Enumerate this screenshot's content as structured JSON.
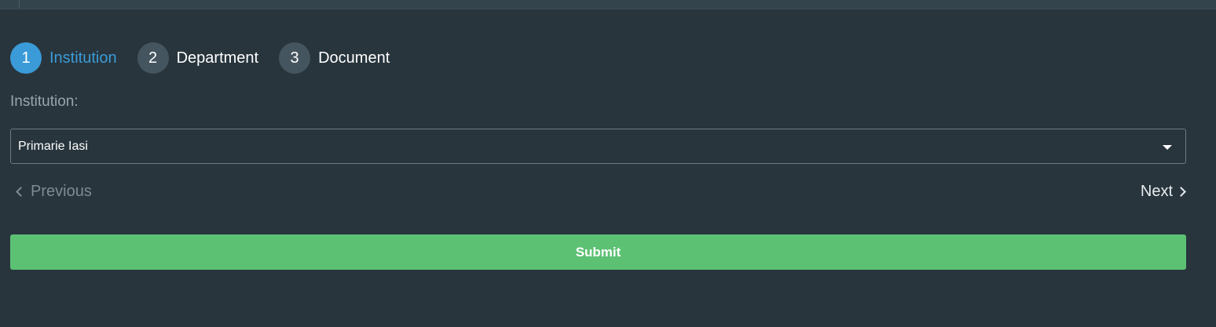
{
  "wizard": {
    "steps": [
      {
        "number": "1",
        "label": "Institution",
        "active": true
      },
      {
        "number": "2",
        "label": "Department",
        "active": false
      },
      {
        "number": "3",
        "label": "Document",
        "active": false
      }
    ]
  },
  "form": {
    "institution_label": "Institution:",
    "institution_value": "Primarie Iasi"
  },
  "navigation": {
    "previous_label": "Previous",
    "next_label": "Next"
  },
  "actions": {
    "submit_label": "Submit"
  },
  "colors": {
    "background": "#28353d",
    "active_step": "#3a9bd8",
    "inactive_step": "#45555f",
    "submit": "#5dc174"
  },
  "icons": {
    "select_caret": "caret-down-icon",
    "previous": "chevron-left-icon",
    "next": "chevron-right-icon"
  }
}
